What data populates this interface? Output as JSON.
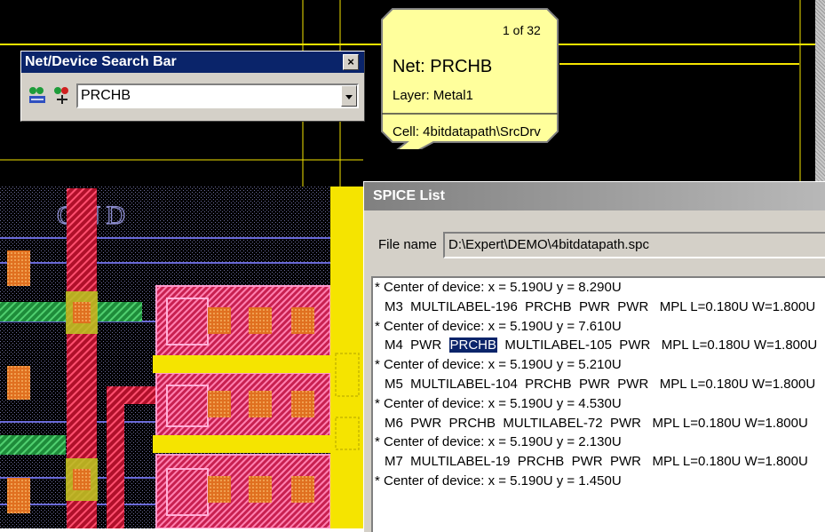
{
  "layout_view": {
    "label": "GND"
  },
  "search_bar": {
    "title": "Net/Device Search Bar",
    "close_label": "×",
    "value": "PRCHB"
  },
  "tooltip": {
    "counter": "1 of 32",
    "net": "Net: PRCHB",
    "layer": "Layer: Metal1",
    "cell": "Cell: 4bitdatapath\\SrcDrv"
  },
  "spice_list": {
    "title": "SPICE List",
    "file_label": "File name",
    "file_value": "D:\\Expert\\DEMO\\4bitdatapath.spc",
    "lines": [
      {
        "text": "* Center of device: x = 5.190U y = 8.290U"
      },
      {
        "text": "M3  MULTILABEL-196  PRCHB  PWR  PWR   MPL L=0.180U W=1.800U"
      },
      {
        "text": "* Center of device: x = 5.190U y = 7.610U"
      },
      {
        "before": "M4  PWR  ",
        "highlight": "PRCHB",
        "after": "  MULTILABEL-105  PWR   MPL L=0.180U W=1.800U"
      },
      {
        "text": "* Center of device: x = 5.190U y = 5.210U"
      },
      {
        "text": "M5  MULTILABEL-104  PRCHB  PWR  PWR   MPL L=0.180U W=1.800U"
      },
      {
        "text": "* Center of device: x = 5.190U y = 4.530U"
      },
      {
        "text": "M6  PWR  PRCHB  MULTILABEL-72  PWR   MPL L=0.180U W=1.800U"
      },
      {
        "text": "* Center of device: x = 5.190U y = 2.130U"
      },
      {
        "text": "M7  MULTILABEL-19  PRCHB  PWR  PWR   MPL L=0.180U W=1.800U"
      },
      {
        "text": "* Center of device: x = 5.190U y = 1.450U"
      }
    ]
  },
  "colors": {
    "metal_yellow": "#f5e400",
    "poly_red": "#c8102e",
    "contact_orange": "#e07020",
    "diffusion_green": "#2aa84a",
    "metal_blue": "#6a6ad8",
    "selection_blue": "#0a246a"
  }
}
